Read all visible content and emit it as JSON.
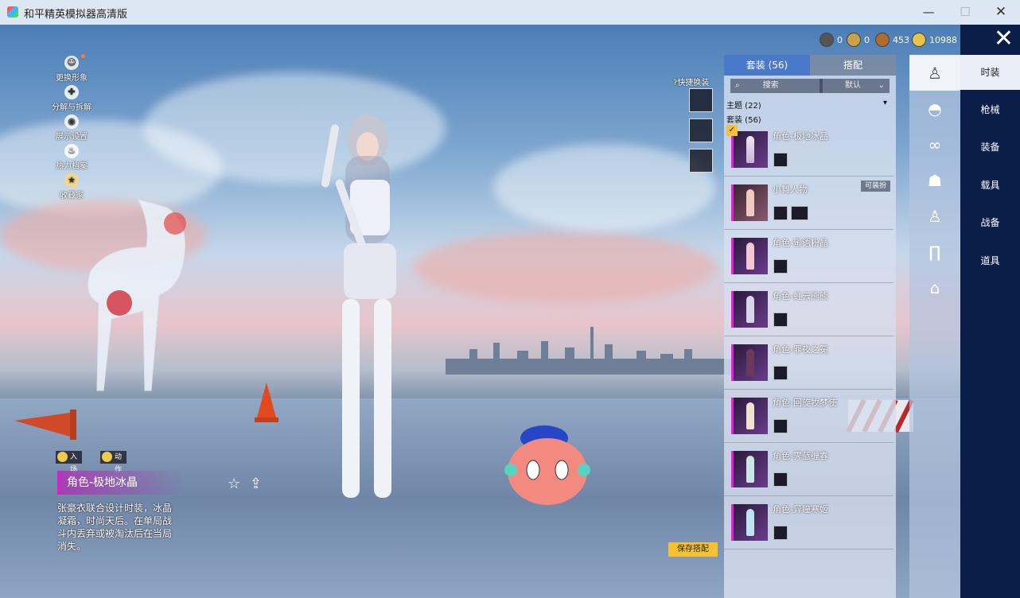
{
  "window": {
    "title": "和平精英模拟器高清版",
    "minimize": "—",
    "maximize": "☐",
    "close": "✕"
  },
  "left_menu": [
    {
      "label": "更换形象",
      "icon": "avatar-icon"
    },
    {
      "label": "分解与拆解",
      "icon": "puzzle-icon"
    },
    {
      "label": "展示设置",
      "icon": "eye-icon"
    },
    {
      "label": "热力档案",
      "icon": "flame-icon"
    },
    {
      "label": "收藏家",
      "icon": "medal-icon"
    }
  ],
  "currency": [
    {
      "icon": "coin-dark-icon",
      "value": "0"
    },
    {
      "icon": "coin-gold-ring-icon",
      "value": "0"
    },
    {
      "icon": "coin-bronze-icon",
      "value": "453"
    },
    {
      "icon": "coin-yellow-icon",
      "value": "10988"
    }
  ],
  "quick_change": {
    "label": "快捷换装",
    "help_icon": "?"
  },
  "panel": {
    "tabs": [
      "套装 (56)",
      "搭配"
    ],
    "search_placeholder": "搜索",
    "sort_label": "默认",
    "section_theme": "主题 (22)",
    "section_suits": "套装 (56)",
    "items": [
      {
        "name": "角色-极地冰晶",
        "badge": "",
        "minis": 1,
        "selected": true
      },
      {
        "name": "小舞人物",
        "badge": "可装扮",
        "minis": 2,
        "selected": false
      },
      {
        "name": "角色-蜜语粉晶",
        "badge": "",
        "minis": 1,
        "selected": false
      },
      {
        "name": "角色-虹云熊熊",
        "badge": "",
        "minis": 1,
        "selected": false
      },
      {
        "name": "角色-罪夜之冕",
        "badge": "",
        "minis": 1,
        "selected": false
      },
      {
        "name": "角色-回旋牧梦使",
        "badge": "",
        "minis": 1,
        "selected": false
      },
      {
        "name": "角色-霁蓝缠春",
        "badge": "",
        "minis": 1,
        "selected": false
      },
      {
        "name": "角色-异瞳寒姬",
        "badge": "",
        "minis": 1,
        "selected": false
      }
    ]
  },
  "category_icons": [
    "outfit-icon",
    "cap-icon",
    "glasses-icon",
    "mask-icon",
    "body-icon",
    "pants-icon",
    "shoes-icon"
  ],
  "right_nav": [
    "时装",
    "枪械",
    "装备",
    "载具",
    "战备",
    "道具"
  ],
  "actions": {
    "entry": "入场",
    "motion": "动作"
  },
  "character": {
    "name": "角色-极地冰晶",
    "desc": "张豪衣联合设计时装，冰晶凝霜，时尚天后。在单局战斗内丢弃或被淘汰后在当局消失。"
  },
  "save_button": "保存搭配",
  "colors": {
    "accent": "#4a79c9",
    "rarity": "#e61ee0",
    "nav": "#0b1e4a",
    "save": "#f6c233"
  }
}
